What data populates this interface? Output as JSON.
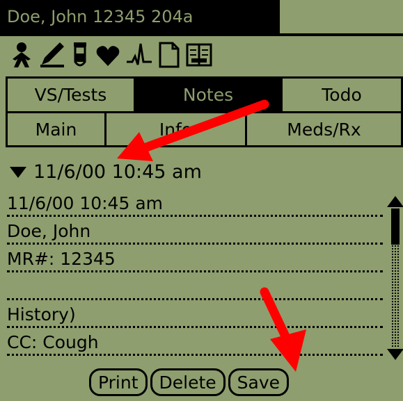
{
  "title_bar": {
    "patient_label": "Doe, John 12345 204a"
  },
  "icons": [
    "person-icon",
    "pen-icon",
    "vial-icon",
    "heart-icon",
    "ekg-icon",
    "document-icon",
    "book-icon"
  ],
  "tabs_row1": [
    {
      "label": "VS/Tests",
      "active": false
    },
    {
      "label": "Notes",
      "active": true
    },
    {
      "label": "Todo",
      "active": false
    }
  ],
  "tabs_row2": [
    {
      "label": "Main"
    },
    {
      "label": "Info"
    },
    {
      "label": "Meds/Rx"
    }
  ],
  "date_picker": {
    "value": "11/6/00 10:45 am"
  },
  "note_lines": [
    "11/6/00 10:45 am",
    "Doe, John",
    "MR#: 12345",
    "",
    "History)",
    "CC: Cough"
  ],
  "buttons": {
    "print": "Print",
    "delete": "Delete",
    "save": "Save"
  },
  "colors": {
    "screen_bg": "#8e9e6e",
    "ink": "#000000",
    "annotation_arrow": "#ff0000"
  }
}
